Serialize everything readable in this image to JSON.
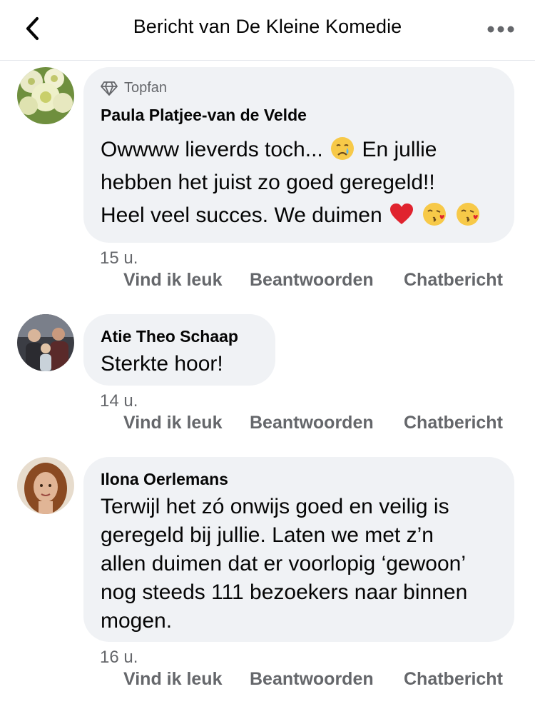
{
  "header": {
    "title": "Bericht van De Kleine Komedie"
  },
  "comments": [
    {
      "badge": "Topfan",
      "author": "Paula Platjee-van de Velde",
      "text_line1": "Owwww lieverds toch...",
      "text_line1b": "En jullie",
      "text_line2": "hebben het juist zo goed geregeld!!",
      "text_line3": "Heel veel succes. We duimen",
      "time": "15 u.",
      "actions": {
        "like": "Vind ik leuk",
        "reply": "Beantwoorden",
        "message": "Chatbericht"
      }
    },
    {
      "author": "Atie Theo Schaap",
      "text": "Sterkte hoor!",
      "time": "14 u.",
      "actions": {
        "like": "Vind ik leuk",
        "reply": "Beantwoorden",
        "message": "Chatbericht"
      }
    },
    {
      "author": "Ilona Oerlemans",
      "text": "Terwijl het zó onwijs goed en veilig is\ngeregeld bij jullie. Laten we met z’n\nallen duimen dat er voorlopig ‘gewoon’\nnog steeds 111 bezoekers naar binnen\nmogen.",
      "time": "16 u.",
      "actions": {
        "like": "Vind ik leuk",
        "reply": "Beantwoorden",
        "message": "Chatbericht"
      }
    }
  ],
  "colors": {
    "bubble": "#f0f2f5",
    "secondary_text": "#65676b",
    "primary_text": "#050505",
    "divider": "#e4e6eb"
  },
  "icons": [
    "back-arrow-icon",
    "more-dots-icon",
    "diamond-icon",
    "crying-face-emoji",
    "red-heart-emoji",
    "face-blowing-kiss-emoji"
  ]
}
